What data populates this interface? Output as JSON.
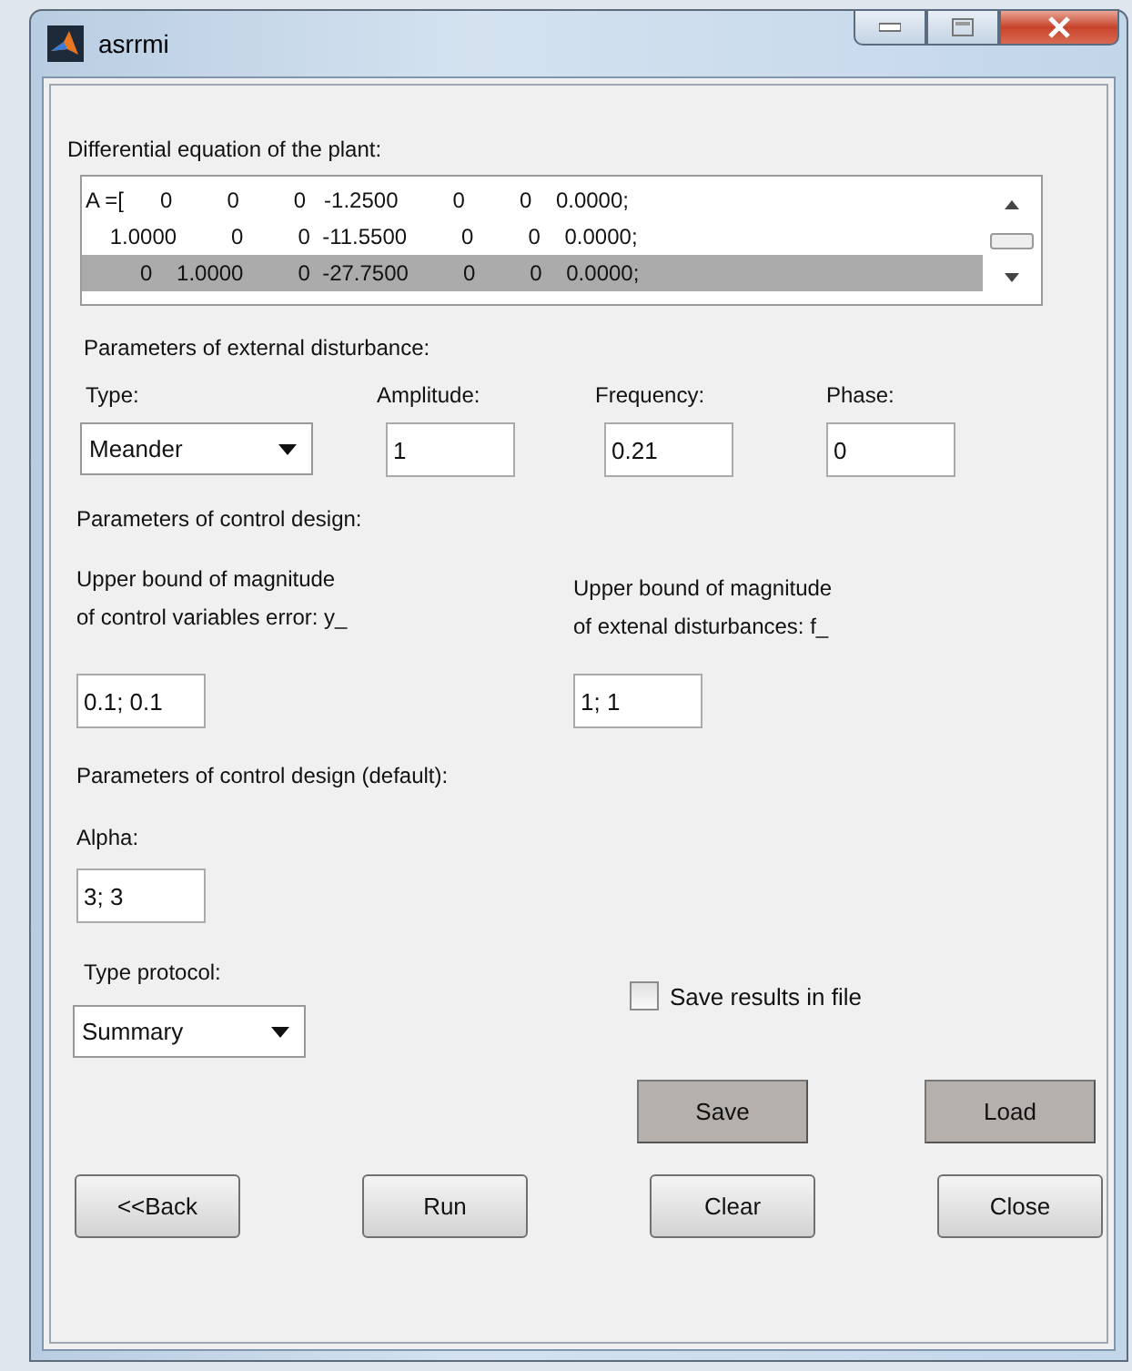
{
  "window": {
    "title": "asrrmi"
  },
  "plant": {
    "label": "Differential equation of the plant:",
    "rows": [
      {
        "text": "A =[      0         0         0   -1.2500         0         0    0.0000;",
        "selected": false
      },
      {
        "text": "    1.0000         0         0  -11.5500         0         0    0.0000;",
        "selected": false
      },
      {
        "text": "         0    1.0000         0  -27.7500         0         0    0.0000;",
        "selected": true
      }
    ]
  },
  "disturbance": {
    "label": "Parameters of external disturbance:",
    "fields": [
      {
        "kind": "dropdown",
        "label": "Type:",
        "value": "Meander"
      },
      {
        "kind": "input",
        "label": "Amplitude:",
        "value": "1"
      },
      {
        "kind": "input",
        "label": "Frequency:",
        "value": "0.21"
      },
      {
        "kind": "input",
        "label": "Phase:",
        "value": "0"
      }
    ]
  },
  "control": {
    "label": "Parameters of control design:",
    "fields": [
      {
        "label": "Upper bound of magnitude\nof control variables error: y_",
        "value": "0.1; 0.1"
      },
      {
        "label": "Upper bound of magnitude\nof extenal disturbances: f_",
        "value": "1; 1"
      }
    ]
  },
  "defaults": {
    "label": "Parameters of control design (default):",
    "alpha_label": "Alpha:",
    "alpha_value": "3; 3"
  },
  "protocol": {
    "label": "Type protocol:",
    "value": "Summary"
  },
  "save_results": {
    "label": "Save results in file",
    "checked": false
  },
  "file_buttons": [
    {
      "label": "Save",
      "kind": "flat"
    },
    {
      "label": "Load",
      "kind": "flat"
    }
  ],
  "buttons": [
    {
      "label": "<<Back",
      "kind": "standard"
    },
    {
      "label": "Run",
      "kind": "standard"
    },
    {
      "label": "Clear",
      "kind": "standard"
    },
    {
      "label": "Close",
      "kind": "standard"
    }
  ]
}
